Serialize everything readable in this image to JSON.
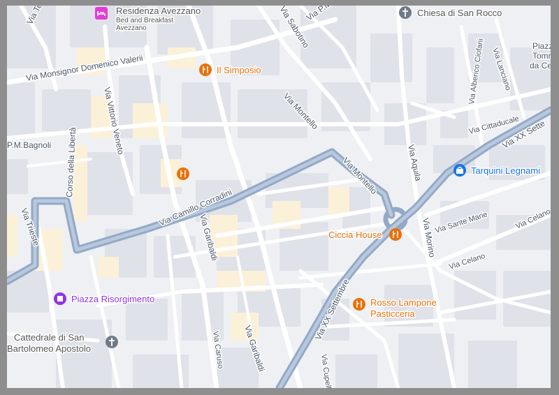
{
  "colors": {
    "block": "#dfe2e8",
    "yellow_block": "#fbf1d8",
    "street": "#ffffff",
    "major_road": "#93a9c6",
    "food_orange": "#e8710a",
    "shop_blue": "#1a73e8",
    "place_purple": "#9334e6",
    "church_gray": "#707a87",
    "hotel_pink": "#e33ad8"
  },
  "streets": {
    "tevere": "Via Tevere",
    "valerii": "Via Monsignor Domenico Valerii",
    "vittorio_veneto": "Via Vittorio Veneto",
    "corso_liberta": "Corso della Libertà",
    "bagnoli": "P.M.Bagnoli",
    "trieste": "Via Trieste",
    "corradini": "Via Camillo Corradini",
    "garibaldi_1": "Via Garibaldi",
    "garibaldi_2": "Via Garibaldi",
    "caruso": "Via Caruso",
    "sabotino": "Via Sabotino",
    "via_p_m": "Via P.M.",
    "montello_1": "Via Montello",
    "montello_2": "Via Montello",
    "aquila": "Via Aquila",
    "cittaducale": "Via Cittaducale",
    "alberico_ciofani": "Via Alberico Ciofani",
    "lanciano": "Via Lanciano",
    "xx_settembre_ne": "Via XX Sette",
    "xx_settembre": "Via XX Settembre",
    "sante_marie": "Via Sante Marie",
    "celano_1": "Via Celano",
    "celano_2": "Via Celano",
    "morino": "Via Morino",
    "cupello": "Via Cupell",
    "piazza_partial": "Piazz",
    "tomm_partial": "Tomm",
    "dacel_partial": "da Cel"
  },
  "pois": {
    "residenza": {
      "name": "Residenza Avezzano",
      "sub1": "Bed and Breakfast",
      "sub2": "Avezzano",
      "icon": "bed-icon"
    },
    "simposio": {
      "name": "Il Simposio",
      "icon": "restaurant-icon"
    },
    "unnamed_restaurant": {
      "icon": "restaurant-icon"
    },
    "chiesa": {
      "name": "Chiesa di San Rocco",
      "icon": "cross-icon"
    },
    "tarquini": {
      "name": "Tarquini Legnami",
      "icon": "shopping-bag-icon"
    },
    "ciccia": {
      "name": "Ciccia House",
      "icon": "restaurant-icon"
    },
    "rosso": {
      "name": "Rosso Lampone",
      "name2": "Pasticceria",
      "icon": "restaurant-icon"
    },
    "piazza": {
      "name": "Piazza Risorgimento",
      "icon": "monument-icon"
    },
    "cattedrale": {
      "name": "Cattedrale di San",
      "name2": "Bartolomeo Apostolo",
      "icon": "cross-icon"
    }
  }
}
